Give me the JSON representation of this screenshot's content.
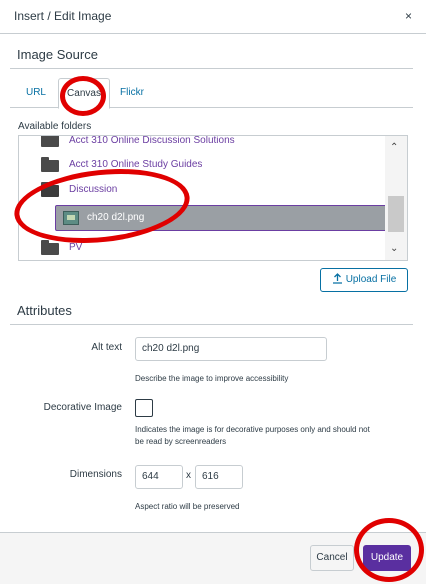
{
  "dialog": {
    "title": "Insert / Edit Image",
    "close_glyph": "×"
  },
  "image_source": {
    "heading": "Image Source",
    "tabs": [
      {
        "label": "URL",
        "active": false
      },
      {
        "label": "Canvas",
        "active": true
      },
      {
        "label": "Flickr",
        "active": false
      }
    ]
  },
  "folders": {
    "label": "Available folders",
    "items": [
      {
        "label": "Acct 310 Online Discussion Solutions"
      },
      {
        "label": "Acct 310 Online Study Guides"
      },
      {
        "label": "Discussion"
      }
    ],
    "selected_file": "ch20 d2l.png",
    "partial_item": "PV"
  },
  "upload": {
    "label": "Upload File",
    "icon": "upload-icon"
  },
  "attributes": {
    "heading": "Attributes",
    "alt_text": {
      "label": "Alt text",
      "value": "ch20 d2l.png",
      "help": "Describe the image to improve accessibility"
    },
    "decorative": {
      "label": "Decorative Image",
      "checked": false,
      "help_line1": "Indicates the image is for decorative purposes only and should not",
      "help_line2": "be read by screenreaders"
    },
    "dimensions": {
      "label": "Dimensions",
      "width": "644",
      "height": "616",
      "separator": "x",
      "help": "Aspect ratio will be preserved"
    }
  },
  "footer": {
    "cancel_label": "Cancel",
    "update_label": "Update"
  },
  "colors": {
    "accent": "#5a2fa0",
    "link": "#0770a3",
    "annotation": "#e00000"
  }
}
